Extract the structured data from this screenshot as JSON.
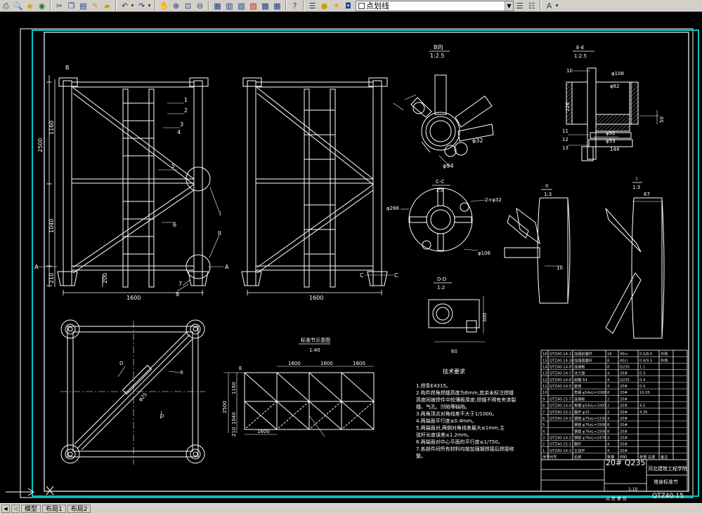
{
  "toolbar": {
    "layer_name": "点划线"
  },
  "status_tabs": [
    "模型",
    "布局1",
    "布局2"
  ],
  "drawing": {
    "views": {
      "b_view": {
        "title": "B向",
        "scale": "1:2.5"
      },
      "e_section": {
        "title": "E-E",
        "scale": "1:2.5"
      },
      "c_section": {
        "title": "C-C",
        "scale": "1:2"
      },
      "d_section": {
        "title": "D-D",
        "scale": "1:2"
      },
      "detail_1": {
        "title": "I",
        "scale": "1:3"
      },
      "detail_2": {
        "title": "II",
        "scale": "1:3"
      },
      "schematic": {
        "title": "标准节示意图",
        "scale": "1:40"
      }
    },
    "dims": {
      "left_h_total": "2500",
      "left_h_upper": "1160",
      "left_h_lower": "1040",
      "left_h_base": "210",
      "width_front": "1600",
      "width_side": "1600",
      "base_offset": "200",
      "top_spans": [
        "1600",
        "1600",
        "1600"
      ],
      "schem_h": "2500",
      "schem_h1": "1160",
      "schem_h2": "1040",
      "schem_h3": "210",
      "schem_w": "1600",
      "c_dia_outer": "φ266",
      "c_dia_inner": "φ106",
      "c_hole": "2×φ32",
      "b_dim_32": "φ32",
      "b_dim_94": "φ94",
      "e_top": "φ108",
      "e_mid": "φ82",
      "e_lower": "φ92",
      "e_bottom": "φ53",
      "e_base": "144",
      "e_h": "126",
      "e_r": "50",
      "d_h": "60",
      "d_v": "300",
      "det2_val": "10",
      "det1_val": "67"
    },
    "labels": {
      "view_b": "B",
      "view_a_left": "A",
      "view_a_right": "A",
      "view_c1": "C",
      "view_c2": "C",
      "view_d1": "D",
      "view_d2": "D",
      "e_mark": "E",
      "leaders": [
        "1",
        "2",
        "3",
        "4",
        "5",
        "6",
        "7",
        "8",
        "9",
        "10",
        "11",
        "12",
        "13"
      ],
      "circle_I": "I",
      "circle_II": "II",
      "plan_dim": "φ25",
      "plan_c": "C"
    },
    "tech_req": {
      "title": "技术要求",
      "lines": [
        "1.焊条E4315。",
        "2.构件焊角焊缝高度为6mm,其余未标注焊缝",
        "  高度同被焊件中较薄板厚度,焊缝不得有夹渣裂",
        "  缝、气孔、凹陷等缺陷。",
        "3.两角顶点对角线差不大于1/1000。",
        "4.两端面平行度≤0.4mm。",
        "5.两端面对,两侧对角线差最大≤1mm,主",
        "  弦杆长度误差≤1.2mm。",
        "6.两端面对中心平面的平行度≤1/750。",
        "7.各部件间所有材料均按加强钢焊接后焊接修",
        "  整。"
      ]
    },
    "parts_table": {
      "rows": [
        [
          "16",
          "QTZ40-14-11",
          "加强斜腹杆",
          "16",
          "40cr",
          "0.5/8.0",
          "外购"
        ],
        [
          "15",
          "QTZ40-14-10",
          "加强直腹杆",
          "8",
          "40cr",
          "0.6/9.5",
          "外购"
        ],
        [
          "14",
          "QTZ40-14-9",
          "连接板",
          "8",
          "Q235",
          "1.1",
          ""
        ],
        [
          "13",
          "QTZ40-14-7",
          "法兰盘",
          "4",
          "20#",
          "0.3",
          ""
        ],
        [
          "12",
          "QTZ40-14-6",
          "斜腹 64",
          "4",
          "Q235",
          "0.4",
          ""
        ],
        [
          "11",
          "QTZ40-14-5",
          "套管",
          "4",
          "20#",
          "0.4",
          ""
        ],
        [
          "10",
          "",
          "角钢 φ54xL=1006",
          "8",
          "20#",
          "10.05",
          ""
        ],
        [
          "9",
          "QTZ40-15-7",
          "连接板",
          "2",
          "20#",
          "",
          ""
        ],
        [
          "8",
          "QTZ40-14-4",
          "角钢 φ54xL=1005",
          "2",
          "20#",
          "4.5",
          ""
        ],
        [
          "7",
          "QTZ40-15-2",
          "腹杆 φ15",
          "2",
          "20#",
          "4.35",
          ""
        ],
        [
          "6",
          "QTZ40-14-3",
          "钢管 φ75xL=1330",
          "4",
          "20#",
          "",
          ""
        ],
        [
          "5",
          "",
          "钢管 φ76xL=1506",
          "8",
          "20#",
          "",
          ""
        ],
        [
          "4",
          "",
          "钢管 φ76xL=1506",
          "8",
          "20#",
          "",
          ""
        ],
        [
          "3",
          "QTZ40-14-2",
          "钢管 φ76xL=2476",
          "4",
          "20#",
          "",
          ""
        ],
        [
          "2",
          "QTZ40-15-1",
          "腹杆",
          "4",
          "20#",
          "",
          ""
        ],
        [
          "1",
          "QTZ40-14-1",
          "主弦杆",
          "4",
          "20#",
          "",
          ""
        ],
        [
          "序号",
          "代号",
          "名称",
          "数量",
          "材料",
          "单重 总重",
          "备注"
        ]
      ],
      "material": "20# Q235",
      "school": "河北建筑工程学院",
      "part_name": "塔身标准节",
      "drawing_no": "QTZ40-15",
      "scale": "1:10",
      "sheet": "共 页 第 页"
    }
  }
}
